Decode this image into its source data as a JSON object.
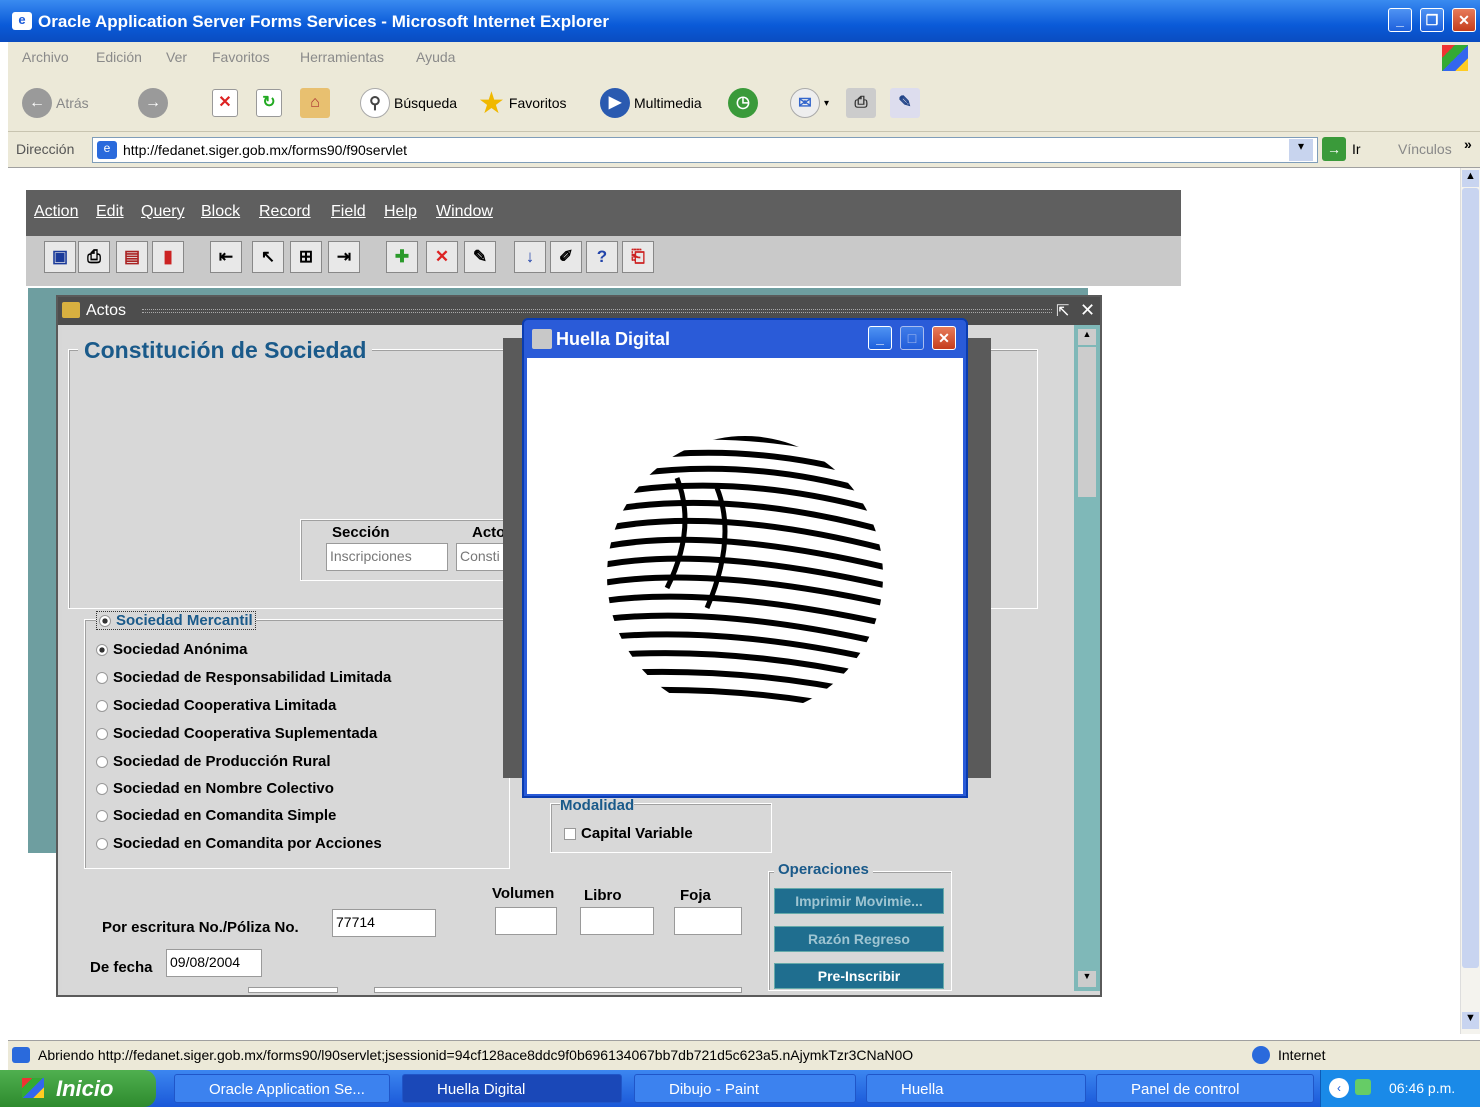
{
  "window": {
    "title": "Oracle Application Server Forms Services - Microsoft Internet Explorer"
  },
  "ie_menu": [
    "Archivo",
    "Edición",
    "Ver",
    "Favoritos",
    "Herramientas",
    "Ayuda"
  ],
  "ie_toolbar": {
    "back": "Atrás",
    "search": "Búsqueda",
    "favorites": "Favoritos",
    "media": "Multimedia"
  },
  "address": {
    "label": "Dirección",
    "url": "http://fedanet.siger.gob.mx/forms90/f90servlet",
    "go": "Ir",
    "links": "Vínculos"
  },
  "forms_menu": [
    "Action",
    "Edit",
    "Query",
    "Block",
    "Record",
    "Field",
    "Help",
    "Window"
  ],
  "actos": {
    "title": "Actos",
    "heading": "Constitución de Sociedad",
    "seccion_label": "Sección",
    "seccion_value": "Inscripciones",
    "acto_label": "Acto",
    "acto_value": "Consti",
    "tipo_group": "Sociedad Mercantil",
    "radios": [
      "Sociedad Anónima",
      "Sociedad de Responsabilidad Limitada",
      "Sociedad Cooperativa Limitada",
      "Sociedad Cooperativa Suplementada",
      "Sociedad de Producción Rural",
      "Sociedad en Nombre Colectivo",
      "Sociedad en Comandita Simple",
      "Sociedad en Comandita por Acciones"
    ],
    "modalidad": "Modalidad",
    "capital_variable": "Capital Variable",
    "volumen": "Volumen",
    "libro": "Libro",
    "foja": "Foja",
    "escritura_label": "Por escritura No./Póliza No.",
    "escritura_value": "77714",
    "fecha_label": "De fecha",
    "fecha_value": "09/08/2004",
    "operaciones": "Operaciones",
    "btn_imprimir": "Imprimir Movimie...",
    "btn_razon": "Razón Regreso",
    "btn_preinscribir": "Pre-Inscribir"
  },
  "huella": {
    "title": "Huella Digital"
  },
  "status": {
    "text": "Abriendo http://fedanet.siger.gob.mx/forms90/l90servlet;jsessionid=94cf128ace8ddc9f0b696134067bb7db721d5c623a5.nAjymkTzr3CNaN0O",
    "zone": "Internet"
  },
  "taskbar": {
    "start": "Inicio",
    "tasks": [
      "Oracle Application Se...",
      "Huella Digital",
      "Dibujo - Paint",
      "Huella",
      "Panel de control"
    ],
    "clock": "06:46 p.m."
  }
}
